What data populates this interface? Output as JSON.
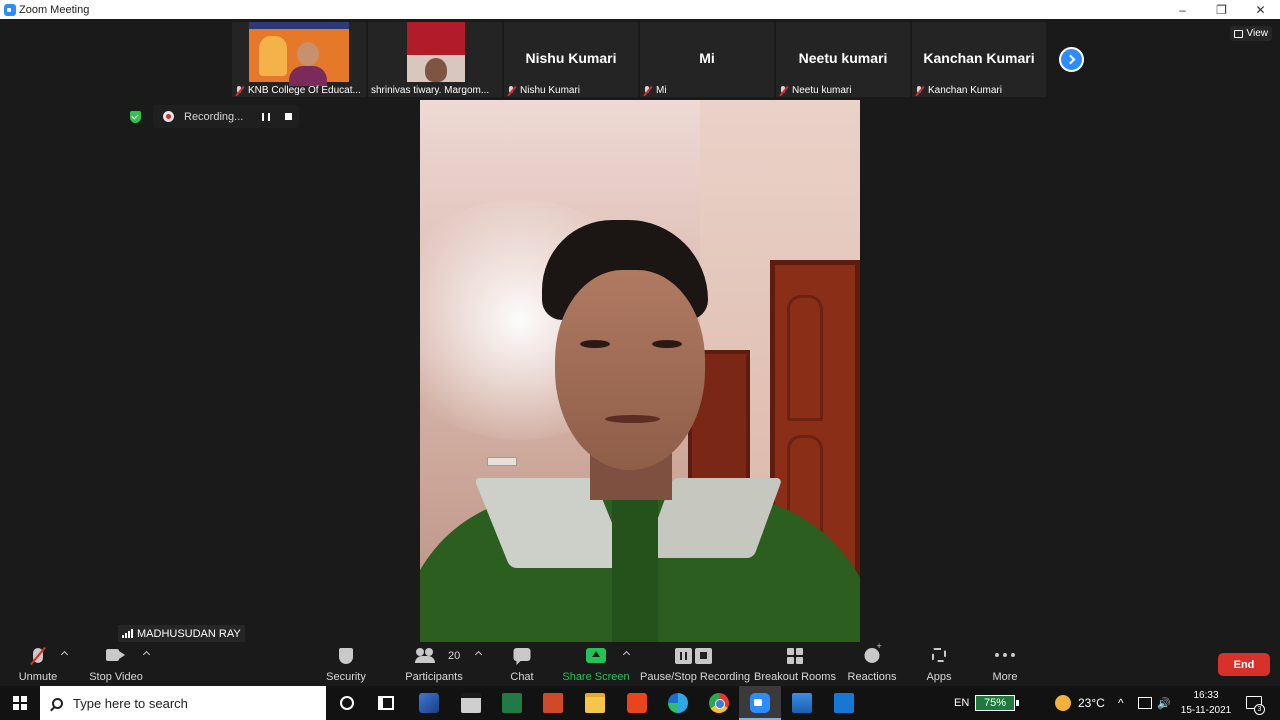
{
  "window": {
    "title": "Zoom Meeting",
    "minimize": "–",
    "maximize": "❐",
    "close": "✕"
  },
  "gallery": {
    "tiles": [
      {
        "label": "KNB College Of Educat..."
      },
      {
        "label": "shrinivas tiwary. Margom..."
      },
      {
        "name": "Nishu Kumari",
        "label": "Nishu Kumari"
      },
      {
        "name": "Mi",
        "label": "Mi"
      },
      {
        "name": "Neetu kumari",
        "label": "Neetu kumari"
      },
      {
        "name": "Kanchan Kumari",
        "label": "Kanchan Kumari"
      }
    ],
    "view_label": "View"
  },
  "recording": {
    "status": "Recording..."
  },
  "active_speaker": {
    "name": "MADHUSUDAN RAY"
  },
  "toolbar": {
    "unmute": "Unmute",
    "stop_video": "Stop Video",
    "security": "Security",
    "participants": "Participants",
    "participant_count": "20",
    "chat": "Chat",
    "share_screen": "Share Screen",
    "pause_stop_recording": "Pause/Stop Recording",
    "breakout_rooms": "Breakout Rooms",
    "reactions": "Reactions",
    "apps": "Apps",
    "more": "More",
    "end": "End"
  },
  "colors": {
    "accent": "#2d8cff",
    "share_green": "#23c35a",
    "end_red": "#d8312b",
    "muted_red": "#e02828"
  },
  "taskbar": {
    "search_placeholder": "Type here to search",
    "language": "EN",
    "battery": "75%",
    "temperature": "23°C",
    "time": "16:33",
    "date": "15-11-2021",
    "notification_count": "3",
    "tray_chevron": "^",
    "tray_volume": "🔊"
  }
}
